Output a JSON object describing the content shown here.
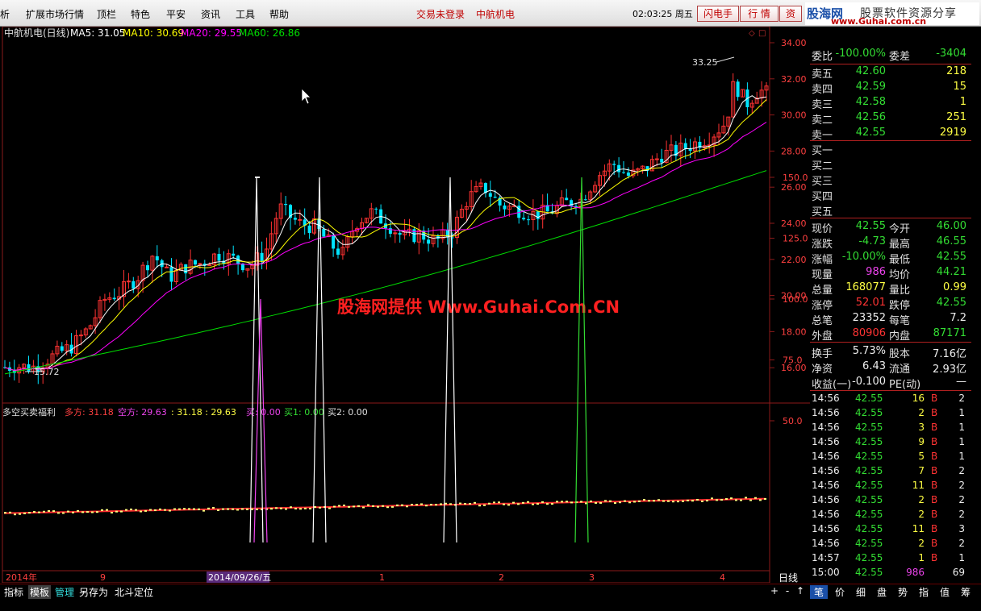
{
  "menu": {
    "items": [
      "析",
      "扩展市场行情",
      "顶栏",
      "特色",
      "平安",
      "资讯",
      "工具",
      "帮助"
    ],
    "status_login": "交易未登录",
    "status_stock": "中航机电",
    "clock": "02:03:25 周五",
    "buttons": [
      "闪电手",
      "行  情",
      "资"
    ]
  },
  "logo": {
    "main": "股海网",
    "sub": "股票软件资源分享",
    "url": "www.Guhai.com.cn"
  },
  "chart": {
    "title": "中航机电(日线)",
    "ma5": "MA5: 31.05",
    "ma10": "MA10: 30.69",
    "ma20": "MA20: 29.55",
    "ma60": "MA60: 26.86",
    "high_label": "33.25",
    "low_label": "15.72",
    "watermark": "股海网提供 Www.Guhai.Com.CN",
    "indicator_name": "多空买卖福利",
    "ind_duofang": "多方: 31.18",
    "ind_kongfang": "空方: 29.63",
    "ind_extra": ": 31.18 : 29.63",
    "ind_mai": "买: 0.00",
    "ind_mai1": "买1: 0.00",
    "ind_mai2": "买2: 0.00",
    "price_axis": [
      "34.00",
      "32.00",
      "30.00",
      "28.00",
      "26.00",
      "24.00",
      "22.00",
      "20.00",
      "18.00",
      "16.00"
    ],
    "ind_axis": [
      "150.0",
      "125.0",
      "100.0",
      "75.0",
      "50.0"
    ],
    "date_labels": [
      "2014年",
      "9",
      "2014/09/26/五",
      "1",
      "2",
      "3",
      "4"
    ],
    "period": "日线",
    "colors": {
      "up": "#ff3232",
      "down": "#00e5ff",
      "ma5": "#ffffff",
      "ma10": "#ffff00",
      "ma20": "#ff00ff",
      "ma60": "#00dd00"
    }
  },
  "quote": {
    "weibi_label": "委比",
    "weibi_value": "-100.00%",
    "weicha_label": "委差",
    "weicha_value": "-3404",
    "asks": [
      {
        "label": "卖五",
        "price": "42.60",
        "vol": "218"
      },
      {
        "label": "卖四",
        "price": "42.59",
        "vol": "15"
      },
      {
        "label": "卖三",
        "price": "42.58",
        "vol": "1"
      },
      {
        "label": "卖二",
        "price": "42.56",
        "vol": "251"
      },
      {
        "label": "卖一",
        "price": "42.55",
        "vol": "2919"
      }
    ],
    "bids": [
      {
        "label": "买一",
        "price": "",
        "vol": ""
      },
      {
        "label": "买二",
        "price": "",
        "vol": ""
      },
      {
        "label": "买三",
        "price": "",
        "vol": ""
      },
      {
        "label": "买四",
        "price": "",
        "vol": ""
      },
      {
        "label": "买五",
        "price": "",
        "vol": ""
      }
    ],
    "stats": [
      {
        "l1": "现价",
        "v1": "42.55",
        "c1": "green",
        "l2": "今开",
        "v2": "46.00",
        "c2": "green"
      },
      {
        "l1": "涨跌",
        "v1": "-4.73",
        "c1": "green",
        "l2": "最高",
        "v2": "46.55",
        "c2": "green"
      },
      {
        "l1": "涨幅",
        "v1": "-10.00%",
        "c1": "green",
        "l2": "最低",
        "v2": "42.55",
        "c2": "green"
      },
      {
        "l1": "现量",
        "v1": "986",
        "c1": "magenta",
        "l2": "均价",
        "v2": "44.21",
        "c2": "green"
      },
      {
        "l1": "总量",
        "v1": "168077",
        "c1": "yellow",
        "l2": "量比",
        "v2": "0.99",
        "c2": "yellow"
      },
      {
        "l1": "涨停",
        "v1": "52.01",
        "c1": "red",
        "l2": "跌停",
        "v2": "42.55",
        "c2": "green"
      },
      {
        "l1": "总笔",
        "v1": "23352",
        "c1": "white",
        "l2": "每笔",
        "v2": "7.2",
        "c2": "white"
      },
      {
        "l1": "外盘",
        "v1": "80906",
        "c1": "red",
        "l2": "内盘",
        "v2": "87171",
        "c2": "green"
      }
    ],
    "stats2": [
      {
        "l1": "换手",
        "v1": "5.73%",
        "c1": "white",
        "l2": "股本",
        "v2": "7.16亿",
        "c2": "white"
      },
      {
        "l1": "净资",
        "v1": "6.43",
        "c1": "white",
        "l2": "流通",
        "v2": "2.93亿",
        "c2": "white"
      },
      {
        "l1": "收益(一)",
        "v1": "-0.100",
        "c1": "white",
        "l2": "PE(动)",
        "v2": "—",
        "c2": "white"
      }
    ],
    "ticks": [
      {
        "time": "14:56",
        "price": "42.55",
        "vol": "16",
        "side": "B",
        "n": "2"
      },
      {
        "time": "14:56",
        "price": "42.55",
        "vol": "2",
        "side": "B",
        "n": "1"
      },
      {
        "time": "14:56",
        "price": "42.55",
        "vol": "3",
        "side": "B",
        "n": "1"
      },
      {
        "time": "14:56",
        "price": "42.55",
        "vol": "9",
        "side": "B",
        "n": "1"
      },
      {
        "time": "14:56",
        "price": "42.55",
        "vol": "5",
        "side": "B",
        "n": "1"
      },
      {
        "time": "14:56",
        "price": "42.55",
        "vol": "7",
        "side": "B",
        "n": "2"
      },
      {
        "time": "14:56",
        "price": "42.55",
        "vol": "11",
        "side": "B",
        "n": "2"
      },
      {
        "time": "14:56",
        "price": "42.55",
        "vol": "2",
        "side": "B",
        "n": "2"
      },
      {
        "time": "14:56",
        "price": "42.55",
        "vol": "2",
        "side": "B",
        "n": "2"
      },
      {
        "time": "14:56",
        "price": "42.55",
        "vol": "11",
        "side": "B",
        "n": "3"
      },
      {
        "time": "14:56",
        "price": "42.55",
        "vol": "2",
        "side": "B",
        "n": "2"
      },
      {
        "time": "14:57",
        "price": "42.55",
        "vol": "1",
        "side": "B",
        "n": "1"
      },
      {
        "time": "15:00",
        "price": "42.55",
        "vol": "986",
        "side": "",
        "n": "69"
      }
    ]
  },
  "bottom": {
    "tabs": [
      "指标",
      "模板",
      "管理",
      "另存为",
      "北斗定位"
    ],
    "right_controls": [
      "+",
      "-",
      "↑"
    ],
    "right_tabs": [
      "笔",
      "价",
      "细",
      "盘",
      "势",
      "指",
      "值",
      "筹"
    ]
  }
}
